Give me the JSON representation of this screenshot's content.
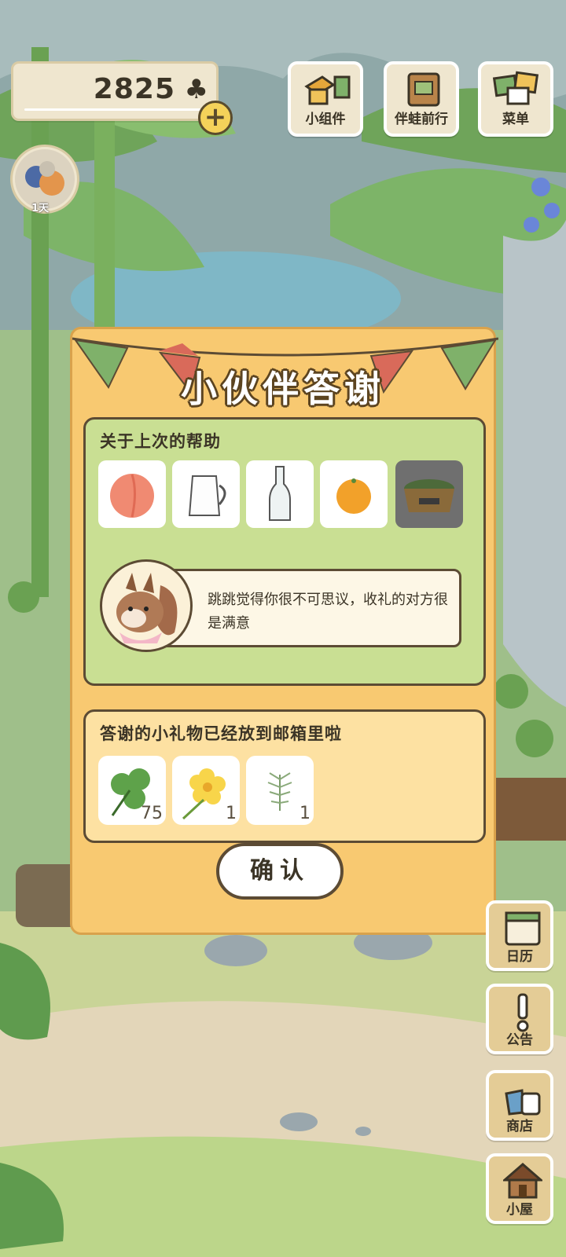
{
  "currency": {
    "clover_count": "2825",
    "clover_icon": "clover-icon",
    "add_icon": "plus-icon"
  },
  "avatar": {
    "day_label": "1天"
  },
  "top_menu": {
    "widgets": "小组件",
    "journey": "伴蛙前行",
    "menu": "菜单"
  },
  "dialog": {
    "title": "小伙伴答谢",
    "help_section_title": "关于上次的帮助",
    "help_items": [
      "peach",
      "milk-pitcher",
      "glass-bottle",
      "orange",
      "noodle-bowl"
    ],
    "message": "跳跳觉得你很不可思议，收礼的对方很是满意",
    "gift_section_title": "答谢的小礼物已经放到邮箱里啦",
    "gifts": [
      {
        "icon": "clover",
        "count": "75"
      },
      {
        "icon": "yellow-flower",
        "count": "1"
      },
      {
        "icon": "herb-sprig",
        "count": "1"
      }
    ],
    "confirm_label": "确认"
  },
  "side_menu": {
    "calendar": "日历",
    "notice": "公告",
    "shop": "商店",
    "house": "小屋"
  },
  "colors": {
    "dialog_bg": "#f8c971",
    "section_green": "#c9df93",
    "section_cream": "#fde1a2",
    "outline": "#5c4b34"
  }
}
